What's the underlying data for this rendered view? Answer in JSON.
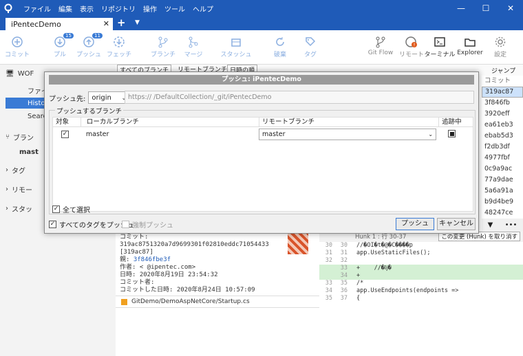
{
  "menu": [
    "ファイル",
    "編集",
    "表示",
    "リポジトリ",
    "操作",
    "ツール",
    "ヘルプ"
  ],
  "tab": {
    "label": "iPentecDemo"
  },
  "toolbar": [
    {
      "label": "コミット",
      "icon": "plus-icon"
    },
    {
      "label": "プル",
      "icon": "pull-icon",
      "badge": "15"
    },
    {
      "label": "プッシュ",
      "icon": "push-icon",
      "badge": "11"
    },
    {
      "label": "フェッチ",
      "icon": "fetch-icon"
    },
    {
      "label": "ブランチ",
      "icon": "branch-icon"
    },
    {
      "label": "マージ",
      "icon": "merge-icon"
    },
    {
      "label": "スタッシュ",
      "icon": "stash-icon"
    },
    {
      "label": "破棄",
      "icon": "discard-icon"
    },
    {
      "label": "タグ",
      "icon": "tag-icon"
    },
    {
      "label": "Git Flow",
      "icon": "gitflow-icon"
    },
    {
      "label": "リモート",
      "icon": "remote-icon"
    },
    {
      "label": "ターミナル",
      "icon": "terminal-icon"
    },
    {
      "label": "Explorer",
      "icon": "folder-icon"
    },
    {
      "label": "設定",
      "icon": "gear-icon"
    }
  ],
  "sidebar": {
    "items": [
      "WOF",
      "ファイ",
      "Histo",
      "Searc",
      "ブラン",
      "mast",
      "タグ",
      "リモー",
      "スタッ"
    ]
  },
  "filters": {
    "branches": "すべてのブランチ",
    "show_remote": "リモートブランチを表示",
    "date_order": "日時の順",
    "jump": "ジャンプ先:"
  },
  "commits": {
    "header": "コミット",
    "list": [
      "319ac87",
      "3f846fb",
      "3920eff",
      "ea61eb3",
      "ebab5d3",
      "f2db3df",
      "4977fbf",
      "0c9a9ac",
      "77a9dae",
      "5a6a91a",
      "b9d4be9",
      "48247ce"
    ]
  },
  "detail": {
    "commit_label": "コミット:",
    "commit_hash": "319ac8751320a7d9699301f02810eddc71054433",
    "short": "[319ac87]",
    "parent_label": "親:",
    "parent": "3f846fbe3f",
    "author": "作者:          <        @ipentec.com>",
    "date": "日時: 2020年8月19日 23:54:32",
    "committer": "コミット者:",
    "commit_date": "コミットした日時: 2020年8月24日 10:57:09",
    "file": "GitDemo/DemoAspNetCore/Startup.cs"
  },
  "diff": {
    "hunk": "Hunk 1 : 行 30-37",
    "discard_hunk": "この変更 (Hunk) を取り消す",
    "lines": [
      {
        "a": "30",
        "b": "30",
        "t": "//�OI�t�@�C����p",
        "type": ""
      },
      {
        "a": "31",
        "b": "31",
        "t": "app.UseStaticFiles();",
        "type": ""
      },
      {
        "a": "32",
        "b": "32",
        "t": "",
        "type": ""
      },
      {
        "a": "",
        "b": "33",
        "t": "+    //�ǉ�",
        "type": "add"
      },
      {
        "a": "",
        "b": "34",
        "t": "+",
        "type": "add"
      },
      {
        "a": "33",
        "b": "35",
        "t": "/*",
        "type": ""
      },
      {
        "a": "34",
        "b": "36",
        "t": "app.UseEndpoints(endpoints =>",
        "type": ""
      },
      {
        "a": "35",
        "b": "37",
        "t": "{",
        "type": ""
      }
    ]
  },
  "dialog": {
    "title": "プッシュ: iPentecDemo",
    "push_to_label": "プッシュ先:",
    "remote": "origin",
    "url": "https://           /DefaultCollection/_git/iPentecDemo",
    "group_label": "プッシュするブランチ",
    "col_target": "対象",
    "col_local": "ローカルブランチ",
    "col_remote": "リモートブランチ",
    "col_track": "追跡中",
    "row_local": "master",
    "row_remote": "master",
    "select_all": "全て選択",
    "push_all_tags": "すべてのタグをプッシュ",
    "force_push": "強制プッシュ",
    "push_btn": "プッシュ",
    "cancel_btn": "キャンセル"
  }
}
